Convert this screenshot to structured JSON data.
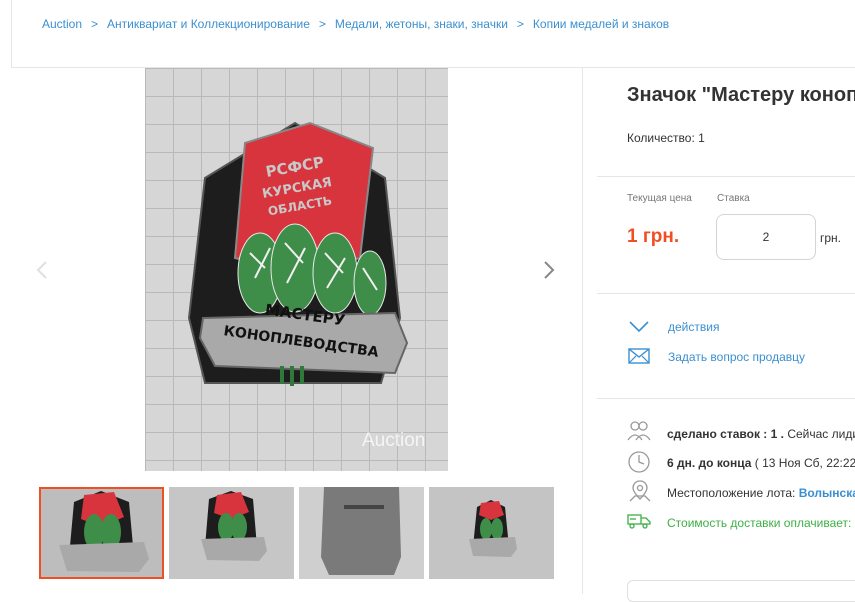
{
  "breadcrumb": {
    "items": [
      "Auction",
      "Антиквариат и Коллекционирование",
      "Медали, жетоны, знаки, значки",
      "Копии медалей и знаков"
    ],
    "separator": ">"
  },
  "product": {
    "title": "Значок \"Мастеру коноп",
    "quantity": "Количество: 1"
  },
  "badge": {
    "top_text_1": "РСФСР",
    "top_text_2": "КУРСКАЯ",
    "top_text_3": "ОБЛАСТЬ",
    "ribbon_1": "МАСТЕРУ",
    "ribbon_2": "КОНОПЛЕВОДСТВА"
  },
  "gallery": {
    "watermark": "Auction"
  },
  "pricing": {
    "current_label": "Текущая цена",
    "bid_label": "Ставка",
    "current_price": "1 грн.",
    "bid_value": "2",
    "currency": "грн."
  },
  "actions": {
    "actions_label": "действия",
    "ask_label": "Задать вопрос продавцу"
  },
  "info": {
    "bids_label": "сделано ставок :",
    "bids_count": "1 .",
    "bids_tail": "Сейчас лиди",
    "days": "6 дн. до конца",
    "end_time": "( 13 Ноя Сб, 22:22",
    "location_label": "Местоположение лота:",
    "location_value": "Волынска",
    "shipping": "Стоимость доставки оплачивает:"
  },
  "colors": {
    "link": "#3b8fd0",
    "price": "#f04e23",
    "green": "#3cb043",
    "badge_red": "#d8343d"
  }
}
